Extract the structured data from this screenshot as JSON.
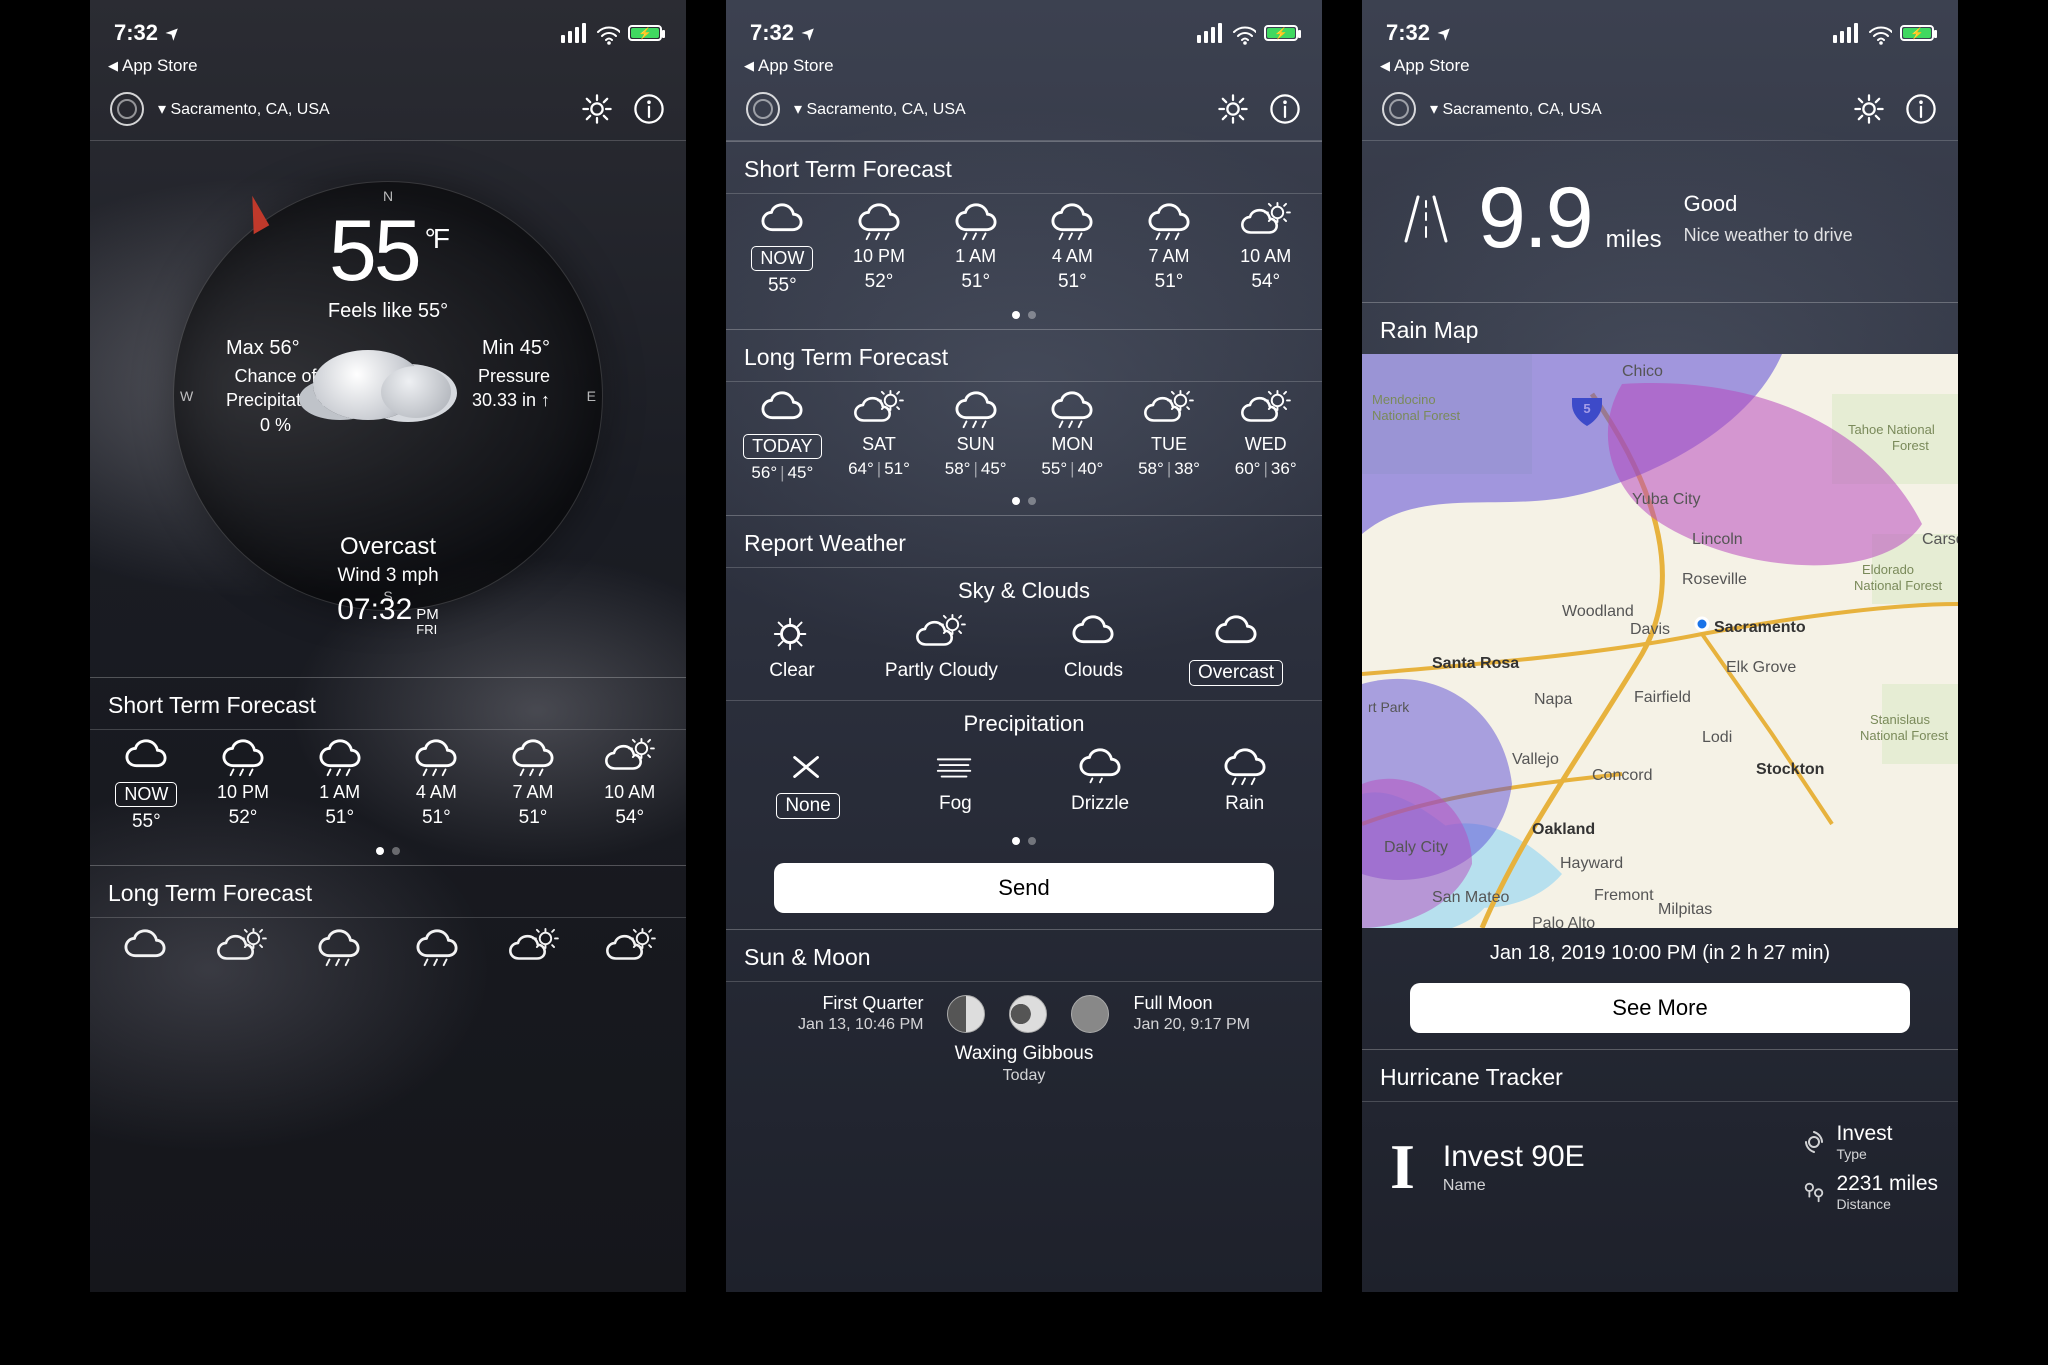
{
  "status": {
    "time": "7:32",
    "back": "App Store"
  },
  "header": {
    "location": "Sacramento, CA, USA"
  },
  "dial": {
    "temp": "55",
    "unit": "°F",
    "feels": "Feels like 55°",
    "max": "Max 56°",
    "min": "Min 45°",
    "precip_label": "Chance of\nPrecipitation",
    "precip_val": "0 %",
    "pressure_label": "Pressure",
    "pressure_val": "30.33 in ↑",
    "condition": "Overcast",
    "wind": "Wind 3 mph",
    "clock": "07:32",
    "ampm": "PM",
    "day": "FRI",
    "compass": {
      "n": "N",
      "s": "S",
      "e": "E",
      "w": "W"
    }
  },
  "sections": {
    "short_title": "Short Term Forecast",
    "long_title": "Long Term Forecast",
    "report_title": "Report Weather",
    "sunmoon_title": "Sun & Moon",
    "rainmap_title": "Rain Map",
    "hurricane_title": "Hurricane Tracker"
  },
  "short": [
    {
      "label": "NOW",
      "temp": "55°",
      "icon": "cloud",
      "boxed": true
    },
    {
      "label": "10 PM",
      "temp": "52°",
      "icon": "cloud-rain"
    },
    {
      "label": "1 AM",
      "temp": "51°",
      "icon": "cloud-rain"
    },
    {
      "label": "4 AM",
      "temp": "51°",
      "icon": "cloud-rain"
    },
    {
      "label": "7 AM",
      "temp": "51°",
      "icon": "cloud-rain"
    },
    {
      "label": "10 AM",
      "temp": "54°",
      "icon": "cloud-sun"
    }
  ],
  "long": [
    {
      "label": "TODAY",
      "hi": "56°",
      "lo": "45°",
      "icon": "cloud",
      "boxed": true
    },
    {
      "label": "SAT",
      "hi": "64°",
      "lo": "51°",
      "icon": "cloud-sun"
    },
    {
      "label": "SUN",
      "hi": "58°",
      "lo": "45°",
      "icon": "cloud-rain"
    },
    {
      "label": "MON",
      "hi": "55°",
      "lo": "40°",
      "icon": "cloud-rain"
    },
    {
      "label": "TUE",
      "hi": "58°",
      "lo": "38°",
      "icon": "cloud-sun"
    },
    {
      "label": "WED",
      "hi": "60°",
      "lo": "36°",
      "icon": "cloud-sun"
    }
  ],
  "report": {
    "sky_label": "Sky & Clouds",
    "sky": [
      {
        "label": "Clear",
        "icon": "sun"
      },
      {
        "label": "Partly Cloudy",
        "icon": "cloud-sun"
      },
      {
        "label": "Clouds",
        "icon": "cloud-outline"
      },
      {
        "label": "Overcast",
        "icon": "cloud",
        "boxed": true
      }
    ],
    "precip_label": "Precipitation",
    "precip": [
      {
        "label": "None",
        "icon": "x",
        "boxed": true
      },
      {
        "label": "Fog",
        "icon": "fog"
      },
      {
        "label": "Drizzle",
        "icon": "cloud-drizzle"
      },
      {
        "label": "Rain",
        "icon": "cloud-rain"
      }
    ],
    "send": "Send"
  },
  "sunmoon": {
    "left_title": "First Quarter",
    "left_sub": "Jan 13, 10:46 PM",
    "center_title": "Waxing Gibbous",
    "center_sub": "Today",
    "right_title": "Full Moon",
    "right_sub": "Jan 20, 9:17 PM"
  },
  "drive": {
    "value": "9.9",
    "unit": "miles",
    "title": "Good",
    "sub": "Nice weather to drive"
  },
  "rainmap": {
    "caption": "Jan 18, 2019 10:00 PM (in 2 h 27 min)",
    "see_more": "See More",
    "cities": [
      "Chico",
      "Yuba City",
      "Lincoln",
      "Roseville",
      "Sacramento",
      "Elk Grove",
      "Woodland",
      "Davis",
      "Santa Rosa",
      "Napa",
      "Fairfield",
      "Vallejo",
      "Concord",
      "Lodi",
      "Stockton",
      "Oakland",
      "Hayward",
      "Fremont",
      "San Mateo",
      "Milpitas",
      "Palo Alto",
      "Carson",
      "Daly City"
    ],
    "labels": [
      "Mendocino National Forest",
      "Tahoe National Forest",
      "Eldorado National Forest",
      "Stanislaus National Forest",
      "rt Park"
    ]
  },
  "hurricane": {
    "symbol": "I",
    "name": "Invest 90E",
    "name_sub": "Name",
    "type": "Invest",
    "type_sub": "Type",
    "distance": "2231 miles",
    "distance_sub": "Distance"
  }
}
